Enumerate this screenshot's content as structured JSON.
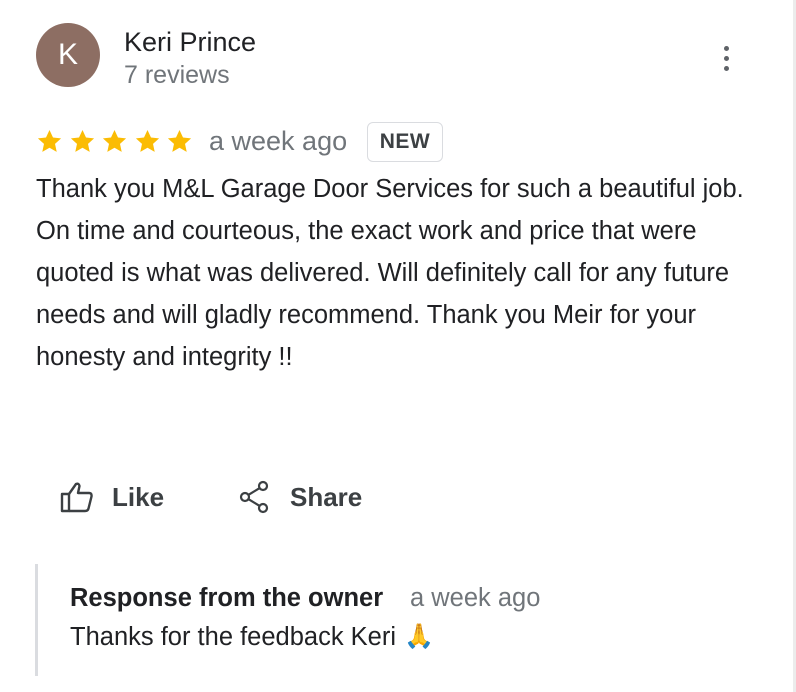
{
  "reviewer": {
    "avatar_letter": "K",
    "avatar_color": "#8d6e63",
    "name": "Keri Prince",
    "reviews_count": "7 reviews"
  },
  "review": {
    "rating": 5,
    "max_rating": 5,
    "star_color": "#fbbc04",
    "time": "a week ago",
    "badge": "NEW",
    "text": "Thank you M&L Garage Door Services for such a beautiful job. On time and courteous, the exact work and price that were quoted is what was delivered. Will definitely call for any future needs and will gladly recommend. Thank you Meir for your honesty and integrity !!"
  },
  "actions": {
    "like_label": "Like",
    "like_icon": "thumbs-up-icon",
    "share_label": "Share",
    "share_icon": "share-icon",
    "menu_icon": "more-vert-icon"
  },
  "owner_response": {
    "title": "Response from the owner",
    "time": "a week ago",
    "text": "Thanks for the feedback Keri",
    "emoji": "🙏"
  }
}
